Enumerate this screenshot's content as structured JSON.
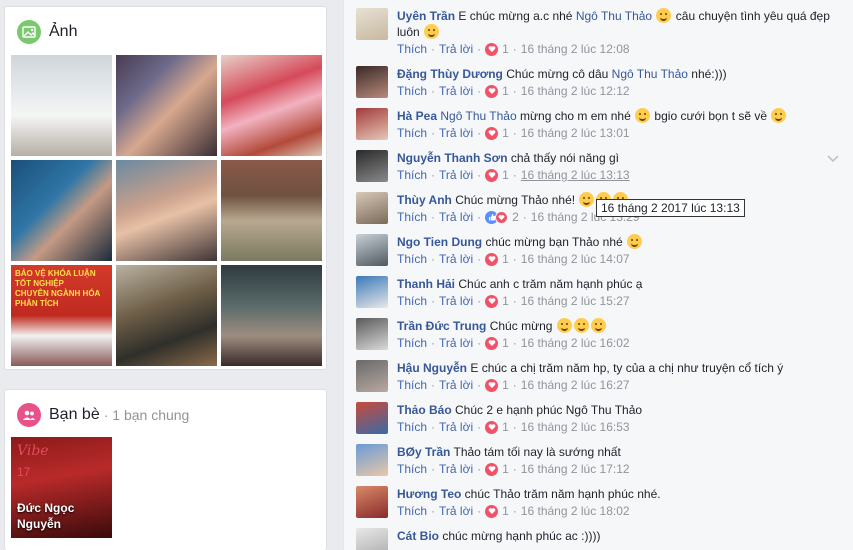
{
  "photos": {
    "title": "Ảnh",
    "icon": "photo-icon",
    "banner_text": "BẢO VỆ KHÓA LUẬN TỐT NGHIỆP\nCHUYÊN NGÀNH HÓA PHÂN TÍCH"
  },
  "friends": {
    "title": "Bạn bè",
    "mutual": "· 1 bạn chung",
    "icon": "friends-icon",
    "tile": {
      "name": "Đức Ngọc Nguyễn",
      "logo_text": "Vibe",
      "number": "17"
    }
  },
  "actions": {
    "like": "Thích",
    "reply": "Trả lời"
  },
  "tooltip": "16 tháng 2 2017 lúc 13:13",
  "comments": [
    {
      "author": "Uyên Trần",
      "text": "E chúc mừng a.c nhé ",
      "mention": "Ngô Thu Thảo",
      "text2": " câu chuyện tình yêu quá đẹp luôn",
      "reactions": "1",
      "time": "16 tháng 2 lúc 12:08"
    },
    {
      "author": "Đặng Thùy Dương",
      "text": "Chúc mừng cô dâu ",
      "mention": "Ngô Thu Thảo",
      "text2": " nhé:)))",
      "reactions": "1",
      "time": "16 tháng 2 lúc 12:12"
    },
    {
      "author": "Hà Pea",
      "text": "",
      "mention": "Ngô Thu Thảo",
      "text2": " mừng cho m em nhé",
      "text3": " bgio cưới bọn t sẽ về",
      "reactions": "1",
      "time": "16 tháng 2 lúc 13:01"
    },
    {
      "author": "Nguyễn Thanh Sơn",
      "text": "chả thấy nói năng gì",
      "reactions": "1",
      "time": "16 tháng 2 lúc 13:13"
    },
    {
      "author": "Thùy Anh",
      "text": "Chúc mừng Thảo nhé!",
      "reactions": "2",
      "time": "16 tháng 2 lúc 13:29"
    },
    {
      "author": "Ngo Tien Dung",
      "text": "chúc mừng bạn Thảo nhé",
      "reactions": "1",
      "time": "16 tháng 2 lúc 14:07"
    },
    {
      "author": "Thanh Hải",
      "text": "Chúc anh c trăm năm hạnh phúc ạ",
      "reactions": "1",
      "time": "16 tháng 2 lúc 15:27"
    },
    {
      "author": "Trần Đức Trung",
      "text": "Chúc mừng",
      "reactions": "1",
      "time": "16 tháng 2 lúc 16:02"
    },
    {
      "author": "Hậu Nguyễn",
      "text": "E chúc a chị trăm năm hp, ty của a chị như truyện cổ tích ý",
      "reactions": "1",
      "time": "16 tháng 2 lúc 16:27"
    },
    {
      "author": "Thảo Báo",
      "text": "Chúc 2 e hạnh phúc Ngô Thu Thảo",
      "reactions": "1",
      "time": "16 tháng 2 lúc 16:53"
    },
    {
      "author": "BØy Trần",
      "text": "Thảo tám tối nay là sướng nhất",
      "reactions": "1",
      "time": "16 tháng 2 lúc 17:12"
    },
    {
      "author": "Hương Teo",
      "text": "chúc Thảo trăm năm hạnh phúc nhé.",
      "reactions": "1",
      "time": "16 tháng 2 lúc 18:02"
    },
    {
      "author": "Cát Bio",
      "text": "chúc mừng hạnh phúc ac :))))"
    }
  ]
}
